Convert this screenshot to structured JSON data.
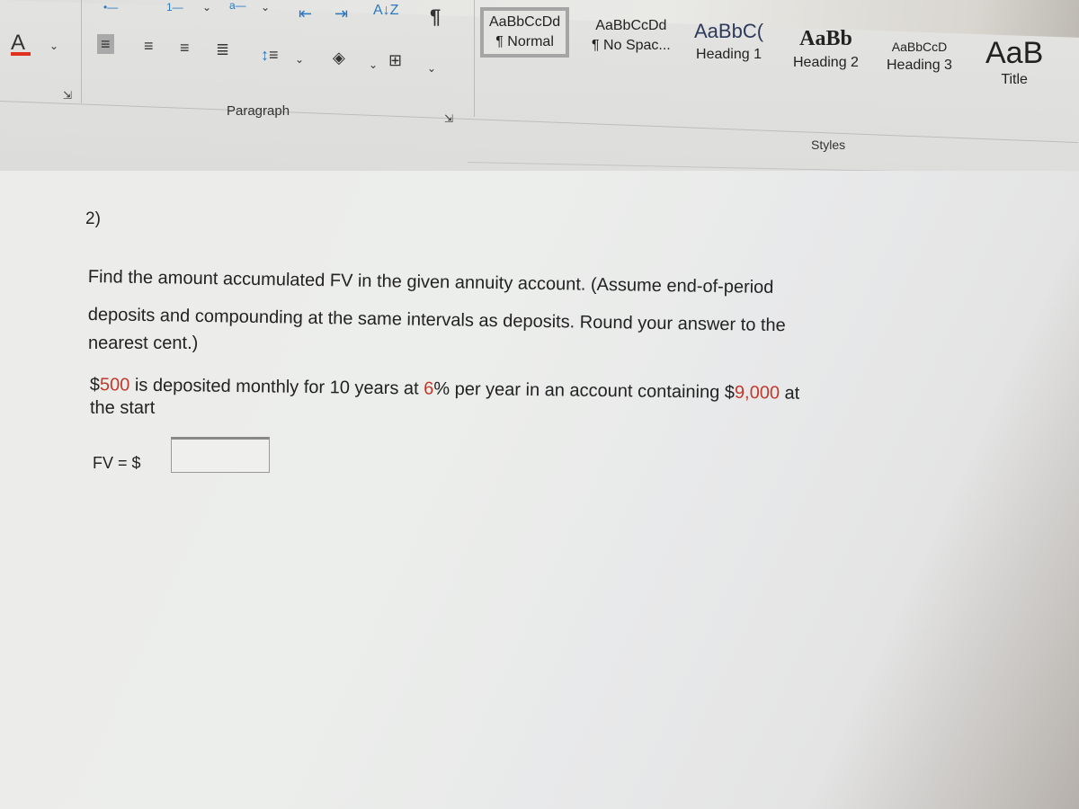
{
  "ribbon": {
    "font": {
      "font_color_icon": "font-color-A",
      "font_color_bar": "#e0301e"
    },
    "paragraph": {
      "label": "Paragraph",
      "icons": [
        "bullets",
        "numbering",
        "multilevel-list",
        "decrease-indent",
        "increase-indent",
        "sort",
        "show-formatting",
        "align-left",
        "align-center",
        "align-right",
        "justify",
        "line-spacing",
        "shading",
        "borders"
      ],
      "sort_glyph": "A↓Z",
      "pilcrow": "¶"
    },
    "styles": {
      "label": "Styles",
      "items": [
        {
          "sample": "AaBbCcDd",
          "name": "¶ Normal",
          "selected": true
        },
        {
          "sample": "AaBbCcDd",
          "name": "¶ No Spac...",
          "selected": false
        },
        {
          "sample": "AaBbC(",
          "name": "Heading 1",
          "selected": false
        },
        {
          "sample": "AaBb",
          "name": "Heading 2",
          "selected": false
        },
        {
          "sample": "AaBbCcD",
          "name": "Heading 3",
          "selected": false
        },
        {
          "sample": "AaB",
          "name": "Title",
          "selected": false
        }
      ]
    }
  },
  "document": {
    "question_number": "2)",
    "instruction_line1": "Find the amount accumulated FV in the given annuity account. (Assume end-of-period",
    "instruction_line2": "deposits and compounding at the same intervals as deposits. Round your answer to the",
    "instruction_line3": "nearest cent.)",
    "problem": {
      "dollar_sign": "$",
      "deposit": "500",
      "text1": " is deposited monthly for 10 years at ",
      "rate": "6",
      "text2": "% per year in an account containing $",
      "initial": "9,000",
      "text3": " at",
      "line2": "the start"
    },
    "answer_label": "FV = $",
    "answer_value": "",
    "highlight_color": "#c0392b"
  }
}
